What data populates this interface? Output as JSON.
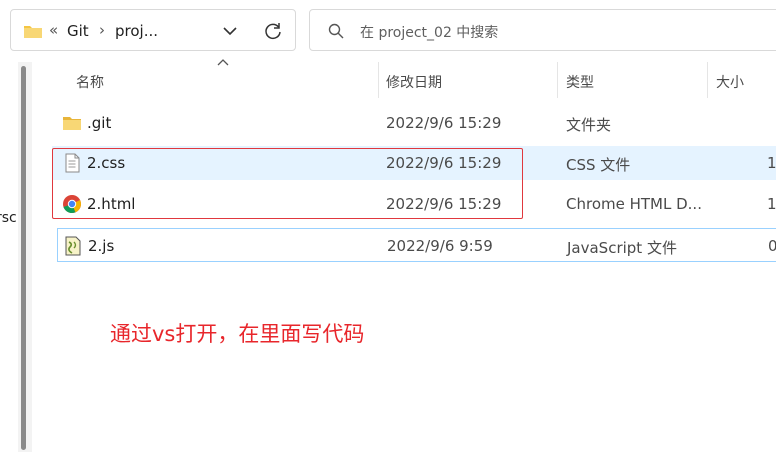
{
  "address_bar": {
    "overflow": "«",
    "crumbs": [
      "Git",
      "proj..."
    ],
    "separator": "›"
  },
  "search": {
    "placeholder": "在 project_02 中搜索"
  },
  "nav": {
    "partial_text": "rsc"
  },
  "columns": {
    "name": "名称",
    "modified": "修改日期",
    "type": "类型",
    "size": "大小"
  },
  "files": [
    {
      "name": ".git",
      "modified": "2022/9/6 15:29",
      "type": "文件夹",
      "size": "",
      "icon": "folder-icon"
    },
    {
      "name": "2.css",
      "modified": "2022/9/6 15:29",
      "type": "CSS 文件",
      "size": "1",
      "icon": "css-file-icon"
    },
    {
      "name": "2.html",
      "modified": "2022/9/6 15:29",
      "type": "Chrome HTML D...",
      "size": "1",
      "icon": "chrome-icon"
    },
    {
      "name": "2.js",
      "modified": "2022/9/6 9:59",
      "type": "JavaScript 文件",
      "size": "0",
      "icon": "js-file-icon"
    }
  ],
  "annotation": "通过vs打开，在里面写代码",
  "colors": {
    "selection": "#e5f3ff",
    "focus_border": "#99d1ff",
    "annotation_red": "#e8262b",
    "folder_yellow": "#f4c542"
  }
}
